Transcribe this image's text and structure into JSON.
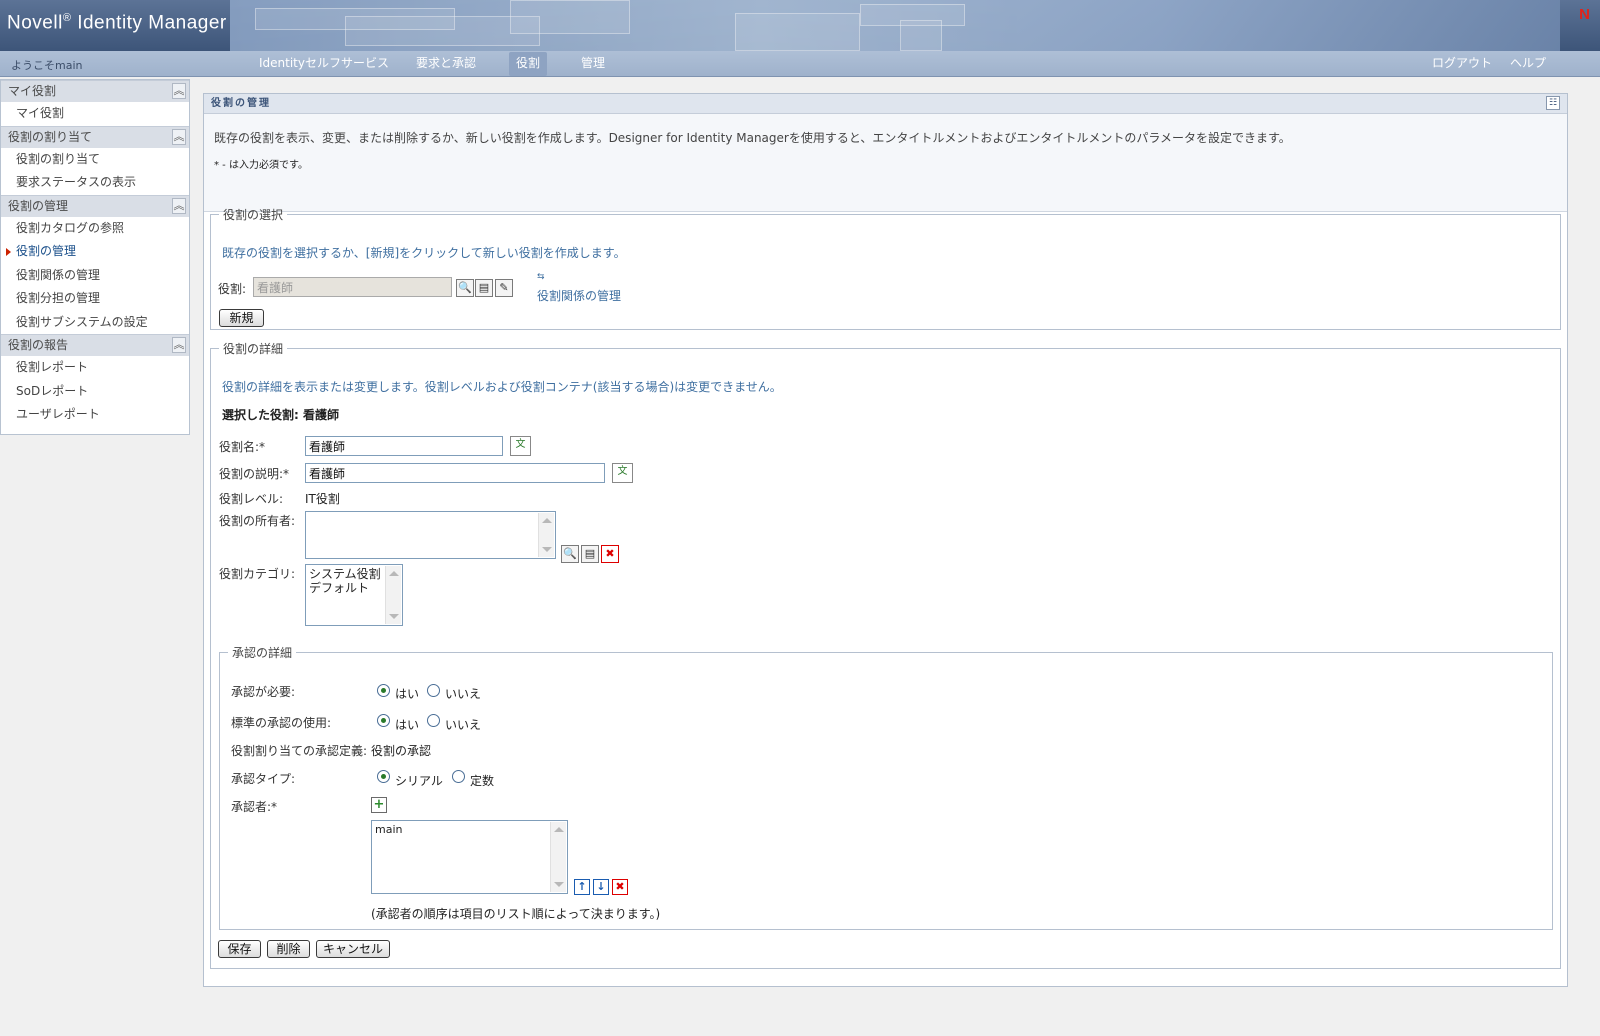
{
  "header": {
    "product": "Novell",
    "registered": "®",
    "product_name": "Identity Manager",
    "corner_logo": "N"
  },
  "navbar": {
    "welcome": "ようこそmain",
    "tabs": [
      "Identityセルフサービス",
      "要求と承認",
      "役割",
      "管理"
    ],
    "active_tab": "役割",
    "logout": "ログアウト",
    "help": "ヘルプ"
  },
  "sidebar": {
    "sections": [
      {
        "title": "マイ役割",
        "items": [
          "マイ役割"
        ]
      },
      {
        "title": "役割の割り当て",
        "items": [
          "役割の割り当て",
          "要求ステータスの表示"
        ]
      },
      {
        "title": "役割の管理",
        "items": [
          "役割カタログの参照",
          "役割の管理",
          "役割関係の管理",
          "役割分担の管理",
          "役割サブシステムの設定"
        ]
      },
      {
        "title": "役割の報告",
        "items": [
          "役割レポート",
          "SoDレポート",
          "ユーザレポート"
        ]
      }
    ],
    "current_item": "役割の管理"
  },
  "panel": {
    "title": "役割の管理",
    "description": "既存の役割を表示、変更、または削除するか、新しい役割を作成します。Designer for Identity Managerを使用すると、エンタイトルメントおよびエンタイトルメントのパラメータを設定できます。",
    "required_note": "* - は入力必須です。"
  },
  "role_select": {
    "legend": "役割の選択",
    "hint": "既存の役割を選択するか、[新規]をクリックして新しい役割を作成します。",
    "role_label": "役割:",
    "role_value": "看護師",
    "manage_relationships_link": "役割関係の管理",
    "new_button": "新規"
  },
  "role_details": {
    "legend": "役割の詳細",
    "hint": "役割の詳細を表示または変更します。役割レベルおよび役割コンテナ(該当する場合)は変更できません。",
    "selected_label": "選択した役割: 看護師",
    "name_label": "役割名:*",
    "name_value": "看護師",
    "description_label": "役割の説明:*",
    "description_value": "看護師",
    "level_label": "役割レベル:",
    "level_value": "IT役割",
    "owner_label": "役割の所有者:",
    "category_label": "役割カテゴリ:",
    "categories": [
      "システム役割",
      "デフォルト"
    ]
  },
  "approval": {
    "legend": "承認の詳細",
    "required_label": "承認が必要:",
    "required_value": "yes",
    "standard_label": "標準の承認の使用:",
    "standard_value": "yes",
    "yes": "はい",
    "no": "いいえ",
    "definition_label": "役割割り当ての承認定義:",
    "definition_value": "役割の承認",
    "type_label": "承認タイプ:",
    "type_serial": "シリアル",
    "type_quorum": "定数",
    "type_value": "serial",
    "approvers_label": "承認者:*",
    "approvers": [
      "main"
    ],
    "approvers_note": "(承認者の順序は項目のリスト順によって決まります。)"
  },
  "actions": {
    "save": "保存",
    "delete": "削除",
    "cancel": "キャンセル"
  }
}
